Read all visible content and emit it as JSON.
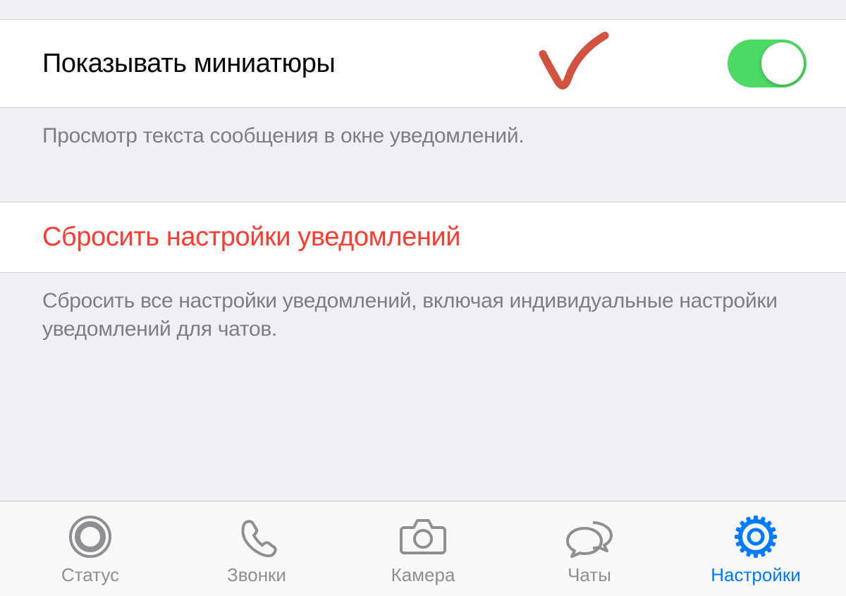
{
  "settings": {
    "show_thumbnails": {
      "label": "Показывать миниатюры",
      "enabled": true,
      "footer": "Просмотр текста сообщения в окне уведомлений."
    },
    "reset": {
      "label": "Сбросить настройки уведомлений",
      "footer": "Сбросить все настройки уведомлений, включая индивидуальные настройки уведомлений для чатов."
    }
  },
  "tabbar": {
    "items": [
      {
        "label": "Статус",
        "icon": "status-icon",
        "active": false
      },
      {
        "label": "Звонки",
        "icon": "calls-icon",
        "active": false
      },
      {
        "label": "Камера",
        "icon": "camera-icon",
        "active": false
      },
      {
        "label": "Чаты",
        "icon": "chats-icon",
        "active": false
      },
      {
        "label": "Настройки",
        "icon": "settings-icon",
        "active": true
      }
    ]
  },
  "annotation": {
    "type": "checkmark",
    "color": "#d0523f"
  },
  "colors": {
    "switch_on": "#4cd964",
    "destructive": "#ff3b30",
    "active_tint": "#007aff",
    "inactive_tint": "#8e8e93"
  }
}
